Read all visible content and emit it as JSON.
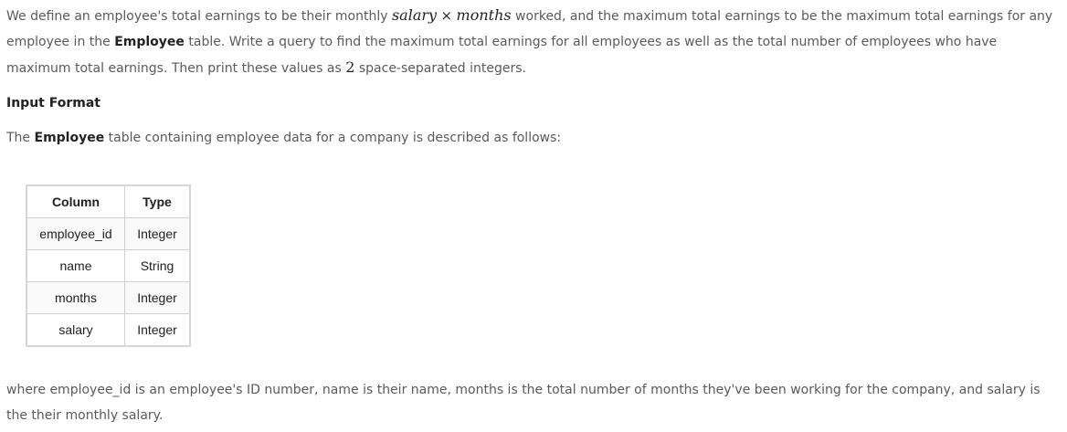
{
  "intro": {
    "part1": "We define an employee's total earnings to be their monthly ",
    "math_salary": "salary",
    "math_times": "×",
    "math_months": "months",
    "part2": " worked, and the maximum total earnings to be the maximum total earnings for any employee in the ",
    "table_name": "Employee",
    "part3": " table. Write a query to find the maximum total earnings for all employees as well as the total number of employees who have maximum total earnings. Then print these values as ",
    "math_two": "2",
    "part4": " space-separated integers."
  },
  "input_format": {
    "heading": "Input Format",
    "part1": "The ",
    "table_name": "Employee",
    "part2": " table containing employee data for a company is described as follows:"
  },
  "schema_table": {
    "headers": [
      "Column",
      "Type"
    ],
    "rows": [
      [
        "employee_id",
        "Integer"
      ],
      [
        "name",
        "String"
      ],
      [
        "months",
        "Integer"
      ],
      [
        "salary",
        "Integer"
      ]
    ]
  },
  "footer_text": "where employee_id is an employee's ID number, name is their name, months is the total number of months they've been working for the company, and salary is the their monthly salary."
}
